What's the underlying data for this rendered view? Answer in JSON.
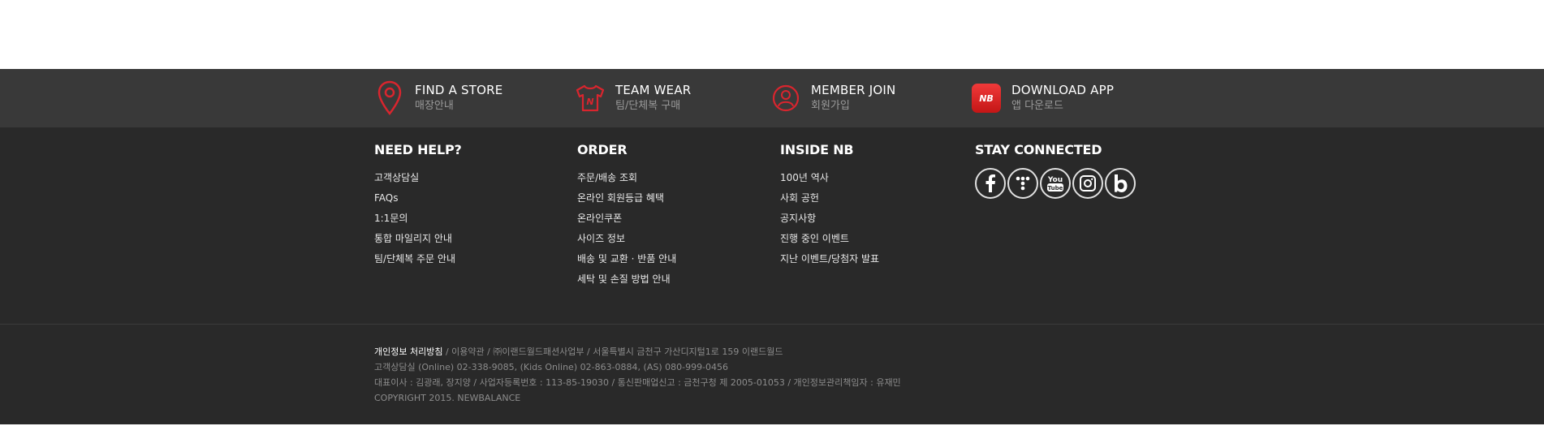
{
  "quick_links": [
    {
      "title": "FIND A STORE",
      "subtitle": "매장안내",
      "icon": "location-pin-icon"
    },
    {
      "title": "TEAM WEAR",
      "subtitle": "팀/단체복 구매",
      "icon": "jersey-icon"
    },
    {
      "title": "MEMBER JOIN",
      "subtitle": "회원가입",
      "icon": "member-icon"
    },
    {
      "title": "DOWNLOAD APP",
      "subtitle": "앱 다운로드",
      "icon": "nb-app-icon"
    }
  ],
  "columns": {
    "help": {
      "title": "NEED HELP?",
      "items": [
        "고객상담실",
        "FAQs",
        "1:1문의",
        "통합 마일리지 안내",
        "팀/단체복 주문 안내"
      ]
    },
    "order": {
      "title": "ORDER",
      "items": [
        "주문/배송 조회",
        "온라인 회원등급 혜택",
        "온라인쿠폰",
        "사이즈 정보",
        "배송 및 교환 · 반품 안내",
        "세탁 및 손질 방법 안내"
      ]
    },
    "inside": {
      "title": "INSIDE NB",
      "items": [
        "100년 역사",
        "사회 공헌",
        "공지사항",
        "진행 중인 이벤트",
        "지난 이벤트/당첨자 발표"
      ]
    },
    "connected": {
      "title": "STAY CONNECTED"
    }
  },
  "social_icons": [
    "facebook-icon",
    "dots-icon",
    "youtube-icon",
    "instagram-icon",
    "blog-icon"
  ],
  "app_logo_text": "NB",
  "legal": {
    "privacy": "개인정보 처리방침",
    "line1_rest": " / 이용약관 / ㈜이랜드월드패션사업부 / 서울특별시 금천구 가산디지털1로 159 이랜드월드",
    "line2": "고객상담실 (Online) 02-338-9085, (Kids Online) 02-863-0884, (AS) 080-999-0456",
    "line3": "대표이사 : 김광래, 장지양 / 사업자등록번호 : 113-85-19030 / 통신판매업신고 : 금천구청 제 2005-01053 / 개인정보관리책임자 : 유재민",
    "copyright": "COPYRIGHT 2015. NEWBALANCE"
  },
  "colors": {
    "accent": "#d9252e",
    "bar": "#393939",
    "footer": "#292929"
  }
}
